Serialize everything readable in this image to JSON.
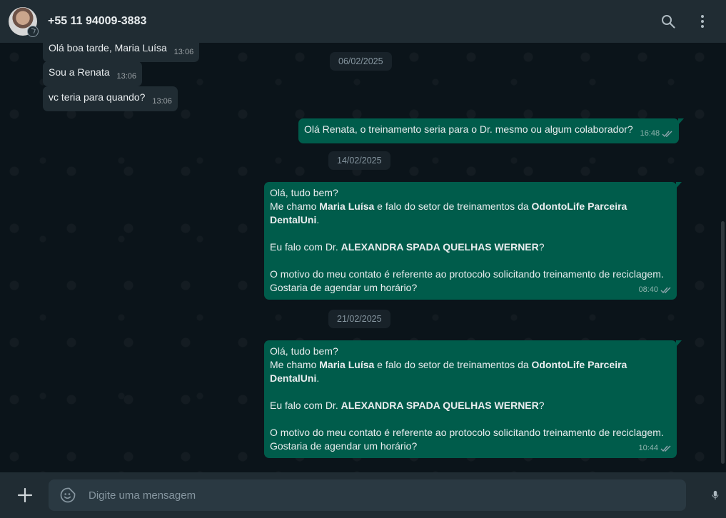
{
  "header": {
    "contact_name": "+55 11 94009-3883"
  },
  "messages": [
    {
      "id": "m1",
      "dir": "in",
      "text": "Olá boa tarde, Maria Luísa",
      "time": "13:06"
    },
    {
      "id": "m2",
      "dir": "in",
      "text": "Sou a Renata",
      "time": "13:06"
    },
    {
      "id": "m3",
      "dir": "in",
      "text": "vc teria para quando?",
      "time": "13:06"
    },
    {
      "id": "m4",
      "dir": "out",
      "text": "Olá Renata, o treinamento seria para o Dr. mesmo ou algum colaborador?",
      "time": "16:48",
      "read": true
    },
    {
      "id": "m5",
      "dir": "out",
      "time": "08:40",
      "read": true,
      "greeting": "Olá, tudo bem?",
      "intro_prefix": "Me chamo ",
      "intro_name": "Maria Luísa",
      "intro_mid": " e falo do setor de treinamentos da ",
      "intro_company": "OdontoLife Parceira DentalUni",
      "intro_suffix": ".",
      "ask_prefix": "Eu falo com Dr. ",
      "ask_name": "ALEXANDRA SPADA QUELHAS WERNER",
      "ask_suffix": "?",
      "reason": "O motivo do meu contato é referente ao protocolo solicitando treinamento de reciclagem. Gostaria de agendar um horário?"
    },
    {
      "id": "m6",
      "dir": "out",
      "time": "10:44",
      "read": true,
      "greeting": "Olá, tudo bem?",
      "intro_prefix": "Me chamo ",
      "intro_name": "Maria Luísa",
      "intro_mid": " e falo do setor de treinamentos da ",
      "intro_company": "OdontoLife Parceira DentalUni",
      "intro_suffix": ".",
      "ask_prefix": "Eu falo com Dr. ",
      "ask_name": "ALEXANDRA SPADA QUELHAS WERNER",
      "ask_suffix": "?",
      "reason": "O motivo do meu contato é referente ao protocolo solicitando treinamento de reciclagem. Gostaria de agendar um horário?"
    }
  ],
  "dates": [
    "06/02/2025",
    "14/02/2025",
    "21/02/2025"
  ],
  "composer": {
    "placeholder": "Digite uma mensagem"
  },
  "icons": {
    "search": "search-icon",
    "menu": "kebab-menu-icon",
    "attach": "plus-icon",
    "emoji": "sticker-icon",
    "mic": "microphone-icon"
  },
  "colors": {
    "header_bg": "#202c33",
    "chat_bg": "#0b141a",
    "incoming_bubble": "#202c33",
    "outgoing_bubble": "#005c4b",
    "read_ticks": "#8696a0"
  }
}
